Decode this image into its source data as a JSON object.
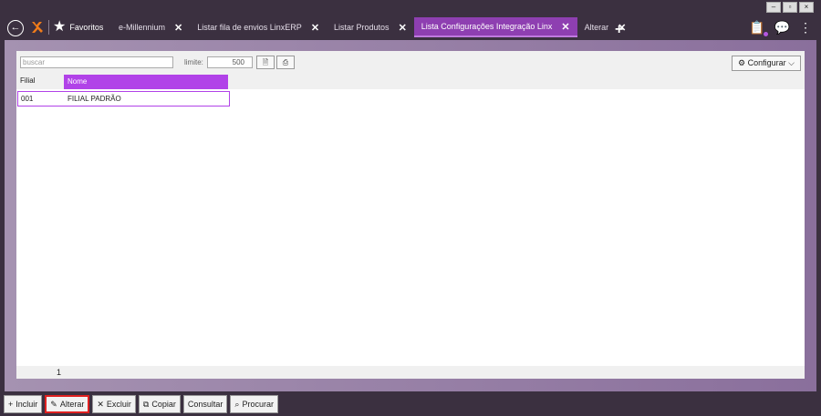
{
  "window": {
    "controls": [
      "–",
      "▫",
      "×"
    ]
  },
  "nav": {
    "back_glyph": "←",
    "favorites_label": "Favoritos",
    "add_tab_glyph": "+"
  },
  "tabs": [
    {
      "label": "e-Millennium",
      "active": false
    },
    {
      "label": "Listar fila de envios LinxERP",
      "active": false
    },
    {
      "label": "Listar Produtos",
      "active": false
    },
    {
      "label": "Lista Configurações Integração Linx",
      "active": true
    },
    {
      "label": "Alterar",
      "active": false
    }
  ],
  "tab_close_glyph": "✕",
  "toolbar": {
    "search_placeholder": "buscar",
    "limite_label": "limite:",
    "limite_value": "500",
    "configurar_label": "Configurar"
  },
  "grid": {
    "columns": [
      "Filial",
      "Nome"
    ],
    "rows": [
      [
        "001",
        "FILIAL PADRÃO"
      ]
    ],
    "footer_count": "1"
  },
  "actions": [
    {
      "icon": "+",
      "label": "Incluir"
    },
    {
      "icon": "✎",
      "label": "Alterar"
    },
    {
      "icon": "✕",
      "label": "Excluir"
    },
    {
      "icon": "⧉",
      "label": "Copiar"
    },
    {
      "icon": "",
      "label": "Consultar"
    },
    {
      "icon": "⌕",
      "label": "Procurar"
    }
  ],
  "colors": {
    "accent": "#b142e8",
    "active_tab": "#8e3fb1",
    "background": "#3b3040"
  }
}
